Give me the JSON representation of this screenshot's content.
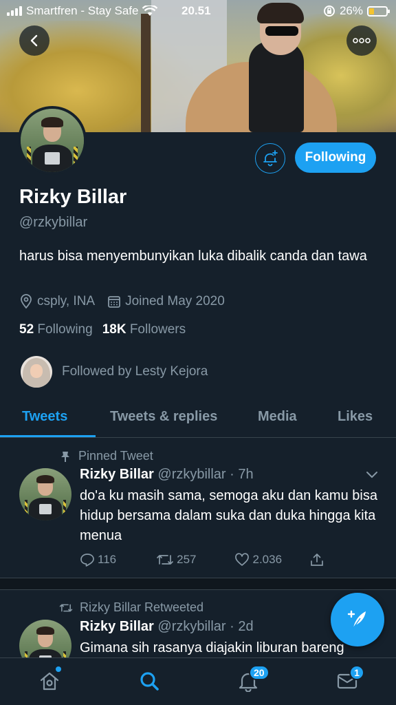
{
  "status_bar": {
    "carrier": "Smartfren - Stay Safe",
    "time": "20.51",
    "battery": "26%"
  },
  "profile": {
    "name": "Rizky Billar",
    "handle": "@rzkybillar",
    "bio": "harus bisa menyembunyikan luka dibalik canda dan tawa",
    "location": "csply, INA",
    "joined": "Joined May 2020",
    "following_count": "52",
    "following_label": "Following",
    "followers_count": "18K",
    "followers_label": "Followers",
    "followed_by": "Followed by Lesty Kejora",
    "follow_button": "Following"
  },
  "tabs": [
    "Tweets",
    "Tweets & replies",
    "Media",
    "Likes"
  ],
  "tweets": [
    {
      "context": "Pinned Tweet",
      "name": "Rizky Billar",
      "meta": "@rzkybillar · 7h",
      "text": "do'a ku masih sama, semoga aku dan kamu bisa hidup bersama dalam suka dan duka hingga kita menua",
      "replies": "116",
      "retweets": "257",
      "likes": "2.036"
    },
    {
      "context": "Rizky Billar Retweeted",
      "name": "Rizky Billar",
      "meta": "@rzkybillar · 2d",
      "text": "Gimana sih rasanya diajakin liburan bareng"
    }
  ],
  "nav": {
    "notifications_badge": "20",
    "messages_badge": "1"
  },
  "colors": {
    "accent": "#1da1f2",
    "background": "#15202b",
    "muted": "#8899a6"
  }
}
